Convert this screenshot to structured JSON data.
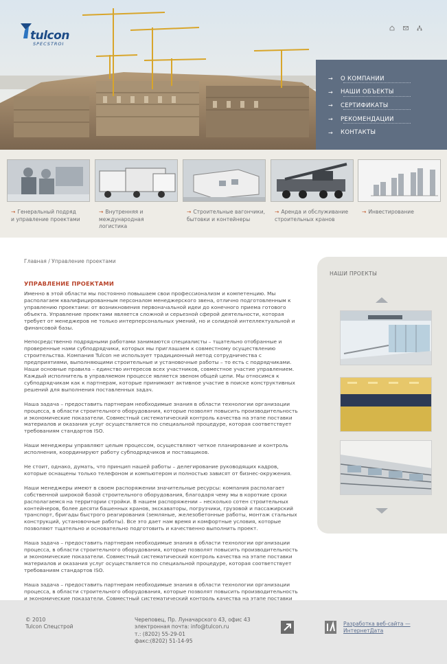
{
  "brand": {
    "name": "tulcon",
    "sub": "SPECSTROI"
  },
  "top_icons": [
    "home-icon",
    "mail-icon",
    "sitemap-icon"
  ],
  "menu": [
    {
      "label": "О КОМПАНИИ"
    },
    {
      "label": "НАШИ ОБЪЕКТЫ"
    },
    {
      "label": "СЕРТИФИКАТЫ"
    },
    {
      "label": "РЕКОМЕНДАЦИИ"
    },
    {
      "label": "КОНТАКТЫ"
    }
  ],
  "services": [
    {
      "line1": "Генеральный подряд",
      "line2": "и управление проектами"
    },
    {
      "line1": "Внутренняя и международная",
      "line2": "логистика"
    },
    {
      "line1": "Строительные вагончики,",
      "line2": "бытовки и контейнеры"
    },
    {
      "line1": "Аренда и обслуживание",
      "line2": "строительных кранов"
    },
    {
      "line1": "Инвестирование",
      "line2": ""
    }
  ],
  "breadcrumb": "Главная / Управление проектами",
  "page_title": "УПРАВЛЕНИЕ ПРОЕКТАМИ",
  "paragraphs": [
    "Именно в этой области мы постоянно повышаем свои профессионализм и компетенцию. Мы располагаем квалифицированным персоналом менеджерского звена, отлично подготовленным к управлению проектами: от возникновения первоначальной идеи до конечного приема готового объекта. Управление проектами является сложной и серьезной сферой деятельности, которая требует от менеджеров не только интерперсональных умений, но и солидной интеллектуальной и финансовой базы.",
    "Непосредственно подрядными работами занимаются специалисты – тщательно отобранные и проверенные нами субподрядчики, которых мы приглашаем к совместному осуществлению строительства. Компания Tulcon не использует традиционный метод сотрудничества с предприятиями, выполняющими строительные и установочные работы – то есть с подрядчиками. Наши основные правила – единство интересов всех участников, совместное участие управлением. Каждый исполнитель в управляемом процессе является звеном общей цепи. Мы относимся к субподрядчикам как к партнерам, которые принимают активное участие в поиске конструктивных решений для выполнения поставленных задач.",
    "Наша задача – предоставить партнерам необходимые знания в области технологии организации процесса, в области строительного оборудования, которые позволят повысить производительность и экономические показатели. Совместный систематический контроль качества на этапе поставки материалов и оказания услуг осуществляется по специальной процедуре, которая соответствует требованиям стандартов ISO.",
    "Наши менеджеры управляют целым процессом, осуществляют четкое планирование и контроль исполнения, координируют работу субподрядчиков и поставщиков.",
    "Не стоит, однако, думать, что принцип нашей работы – делегирование руководящих кадров, которые оснащены только телефоном и компьютером и полностью зависят от бизнес-окружения.",
    "Наши менеджеры имеют в своем распоряжении значительные ресурсы: компания располагает собственной широкой базой строительного оборудования, благодаря чему мы в короткие сроки располагаемся на территории стройки. В нашем распоряжении – несколько сотен строительных контейнеров, более десяти башенных кранов, экскаваторы, погрузчики, грузовой и пассажирский транспорт, бригады быстрого реагирования (земляные, железобетонные работы, монтаж стальных конструкций, установочные работы). Все это дает нам время и комфортные условия, которые позволяют тщательно и основательно подготовить и качественно выполнить проект.",
    "Наша задача – предоставить партнерам необходимые знания в области технологии организации процесса, в области строительного оборудования, которые позволят повысить производительность и экономические показатели. Совместный систематический контроль качества на этапе поставки материалов и оказания услуг осуществляется по специальной процедуре, которая соответствует требованиям стандартов ISO.",
    "Наша задача – предоставить партнерам необходимые знания в области технологии организации процесса, в области строительного оборудования, которые позволят повысить производительность и экономические показатели. Совместный систематический контроль качества на этапе поставки материалов и оказания услуг осуществляется по специальной процедуре, которая соответствует требованиям стандартов ISO."
  ],
  "sidebar": {
    "title": "НАШИ ПРОЕКТЫ"
  },
  "footer": {
    "copy_year": "© 2010",
    "copy_name": "Tulcon Спецстрой",
    "address": "Череповец, Пр. Луначарского 43, офис 43",
    "email": "электронная почта: info@tulcon.ru",
    "phone": "т.: (8202) 55-29-01",
    "fax": "факс:(8202) 51-14-95",
    "dev_line1": "Разработка веб-сайта —",
    "dev_line2": "ИнтернетДата"
  },
  "colors": {
    "menu_bg": "#5f6e82",
    "accent": "#b8432a",
    "brand": "#1c4b87"
  }
}
